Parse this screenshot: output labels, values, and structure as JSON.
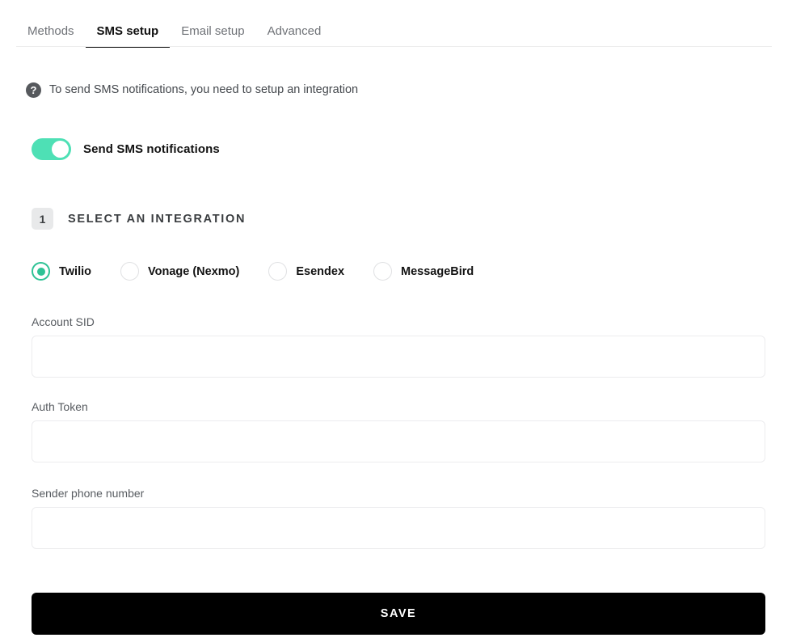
{
  "tabs": [
    {
      "label": "Methods",
      "active": false
    },
    {
      "label": "SMS setup",
      "active": true
    },
    {
      "label": "Email setup",
      "active": false
    },
    {
      "label": "Advanced",
      "active": false
    }
  ],
  "notice": {
    "icon": "help-circle-icon",
    "text": "To send SMS notifications, you need to setup an integration"
  },
  "toggle": {
    "label": "Send SMS notifications",
    "state": "on",
    "on_color": "#4ee0b5",
    "knob_color": "#ffffff"
  },
  "step": {
    "number": "1",
    "title": "SELECT AN INTEGRATION",
    "badge_bg": "#e8e9ea"
  },
  "integrations": {
    "selected": "Twilio",
    "accent_color": "#2ec295",
    "options": [
      {
        "label": "Twilio",
        "selected": true
      },
      {
        "label": "Vonage (Nexmo)",
        "selected": false
      },
      {
        "label": "Esendex",
        "selected": false
      },
      {
        "label": "MessageBird",
        "selected": false
      }
    ]
  },
  "fields": [
    {
      "label": "Account SID",
      "value": "",
      "placeholder": ""
    },
    {
      "label": "Auth Token",
      "value": "",
      "placeholder": ""
    },
    {
      "label": "Sender phone number",
      "value": "",
      "placeholder": ""
    }
  ],
  "save": {
    "label": "SAVE",
    "bg_color": "#000000",
    "text_color": "#ffffff"
  }
}
